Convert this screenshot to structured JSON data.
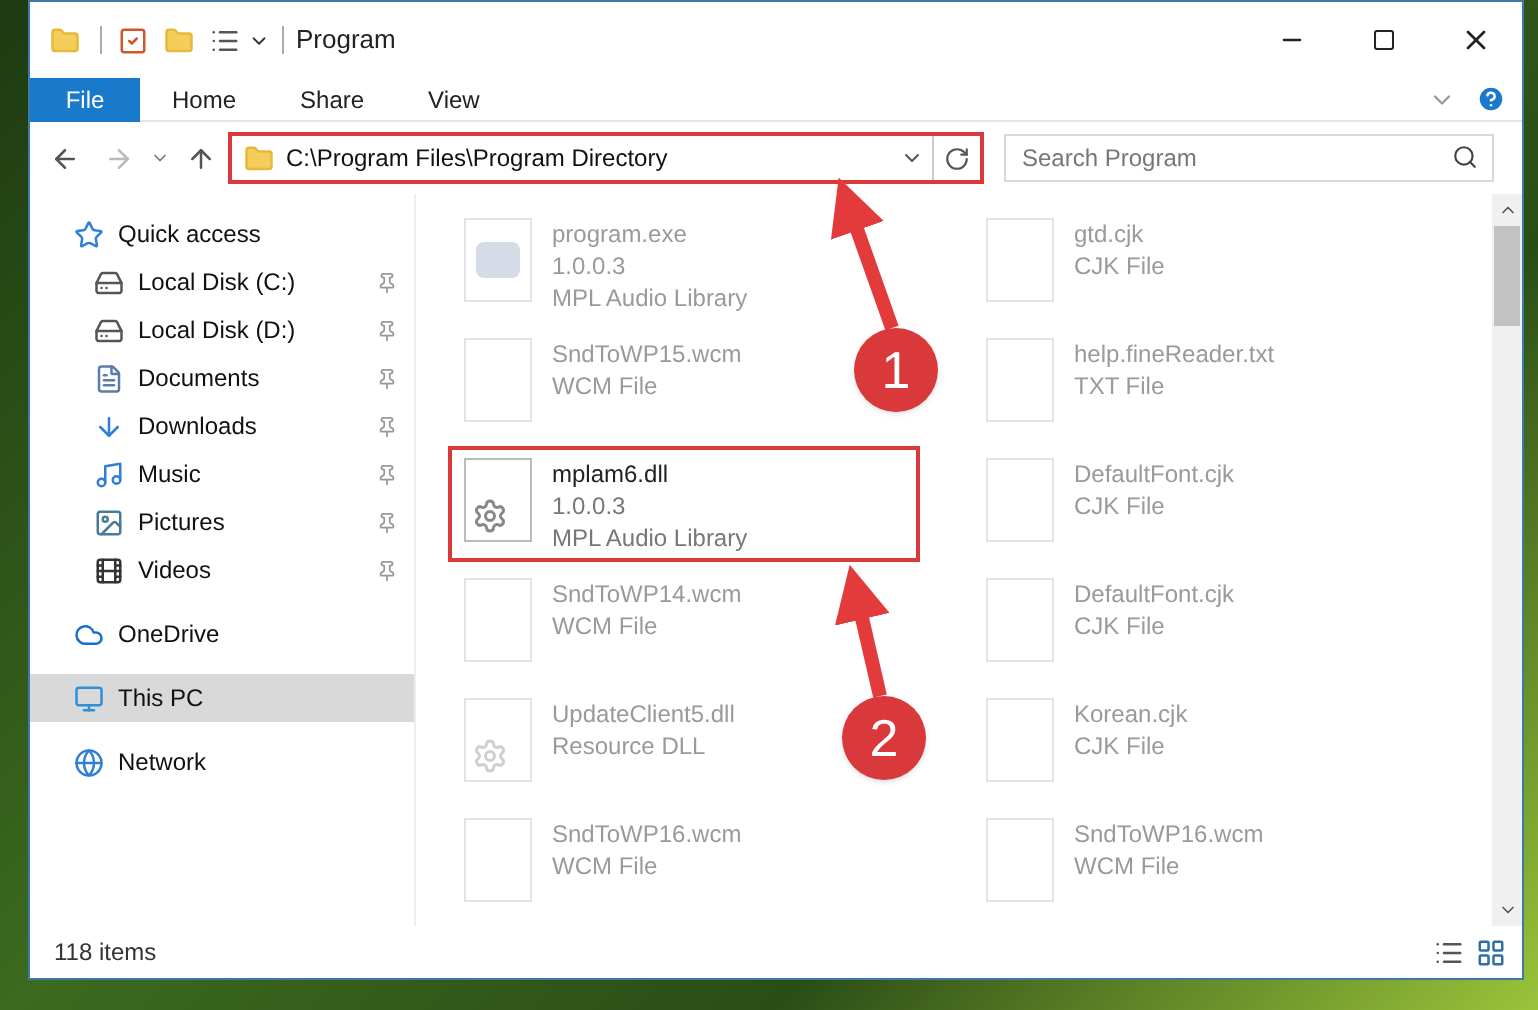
{
  "window": {
    "title": "Program"
  },
  "ribbon_tabs": [
    {
      "label": "File",
      "kind": "file"
    },
    {
      "label": "Home",
      "kind": "tab"
    },
    {
      "label": "Share",
      "kind": "tab"
    },
    {
      "label": "View",
      "kind": "tab"
    }
  ],
  "address_bar": {
    "path": "C:\\Program Files\\Program Directory",
    "highlighted": true
  },
  "search": {
    "placeholder": "Search Program"
  },
  "navigation": [
    {
      "label": "Quick access",
      "kind": "star",
      "selected": false,
      "children": [
        {
          "label": "Local Disk (C:)",
          "kind": "drive",
          "pinned": true,
          "selected": false
        },
        {
          "label": "Local Disk (D:)",
          "kind": "drive",
          "pinned": true,
          "selected": false
        },
        {
          "label": "Documents",
          "kind": "documents",
          "pinned": true,
          "selected": false
        },
        {
          "label": "Downloads",
          "kind": "download",
          "pinned": true,
          "selected": false
        },
        {
          "label": "Music",
          "kind": "music",
          "pinned": true,
          "selected": false
        },
        {
          "label": "Pictures",
          "kind": "pictures",
          "pinned": true,
          "selected": false
        },
        {
          "label": "Videos",
          "kind": "videos",
          "pinned": true,
          "selected": false
        }
      ]
    },
    {
      "label": "OneDrive",
      "kind": "cloud",
      "selected": false
    },
    {
      "label": "This PC",
      "kind": "pc",
      "selected": true
    },
    {
      "label": "Network",
      "kind": "network",
      "selected": false
    }
  ],
  "files": [
    {
      "name": "program.exe",
      "details": [
        "1.0.0.3",
        "MPL Audio Library"
      ],
      "kind": "app",
      "faded": true,
      "highlighted": false
    },
    {
      "name": "gtd.cjk",
      "details": [
        "CJK File"
      ],
      "kind": "generic",
      "faded": true,
      "highlighted": false
    },
    {
      "name": "SndToWP15.wcm",
      "details": [
        "WCM File"
      ],
      "kind": "generic",
      "faded": true,
      "highlighted": false
    },
    {
      "name": "help.fineReader.txt",
      "details": [
        "TXT File"
      ],
      "kind": "text",
      "faded": true,
      "highlighted": false
    },
    {
      "name": "mplam6.dll",
      "details": [
        "1.0.0.3",
        "MPL Audio Library"
      ],
      "kind": "dll",
      "faded": false,
      "highlighted": true
    },
    {
      "name": "DefaultFont.cjk",
      "details": [
        "CJK File"
      ],
      "kind": "generic",
      "faded": true,
      "highlighted": false
    },
    {
      "name": "SndToWP14.wcm",
      "details": [
        "WCM File"
      ],
      "kind": "generic",
      "faded": true,
      "highlighted": false
    },
    {
      "name": "DefaultFont.cjk",
      "details": [
        "CJK File"
      ],
      "kind": "generic",
      "faded": true,
      "highlighted": false
    },
    {
      "name": "UpdateClient5.dll",
      "details": [
        "Resource DLL"
      ],
      "kind": "dll",
      "faded": true,
      "highlighted": false
    },
    {
      "name": "Korean.cjk",
      "details": [
        "CJK File"
      ],
      "kind": "generic",
      "faded": true,
      "highlighted": false
    },
    {
      "name": "SndToWP16.wcm",
      "details": [
        "WCM File"
      ],
      "kind": "generic",
      "faded": true,
      "highlighted": false
    },
    {
      "name": "SndToWP16.wcm",
      "details": [
        "WCM File"
      ],
      "kind": "generic",
      "faded": true,
      "highlighted": false
    }
  ],
  "status_bar": {
    "item_count": "118 items"
  },
  "annotations": [
    {
      "label": "1"
    },
    {
      "label": "2"
    }
  ]
}
